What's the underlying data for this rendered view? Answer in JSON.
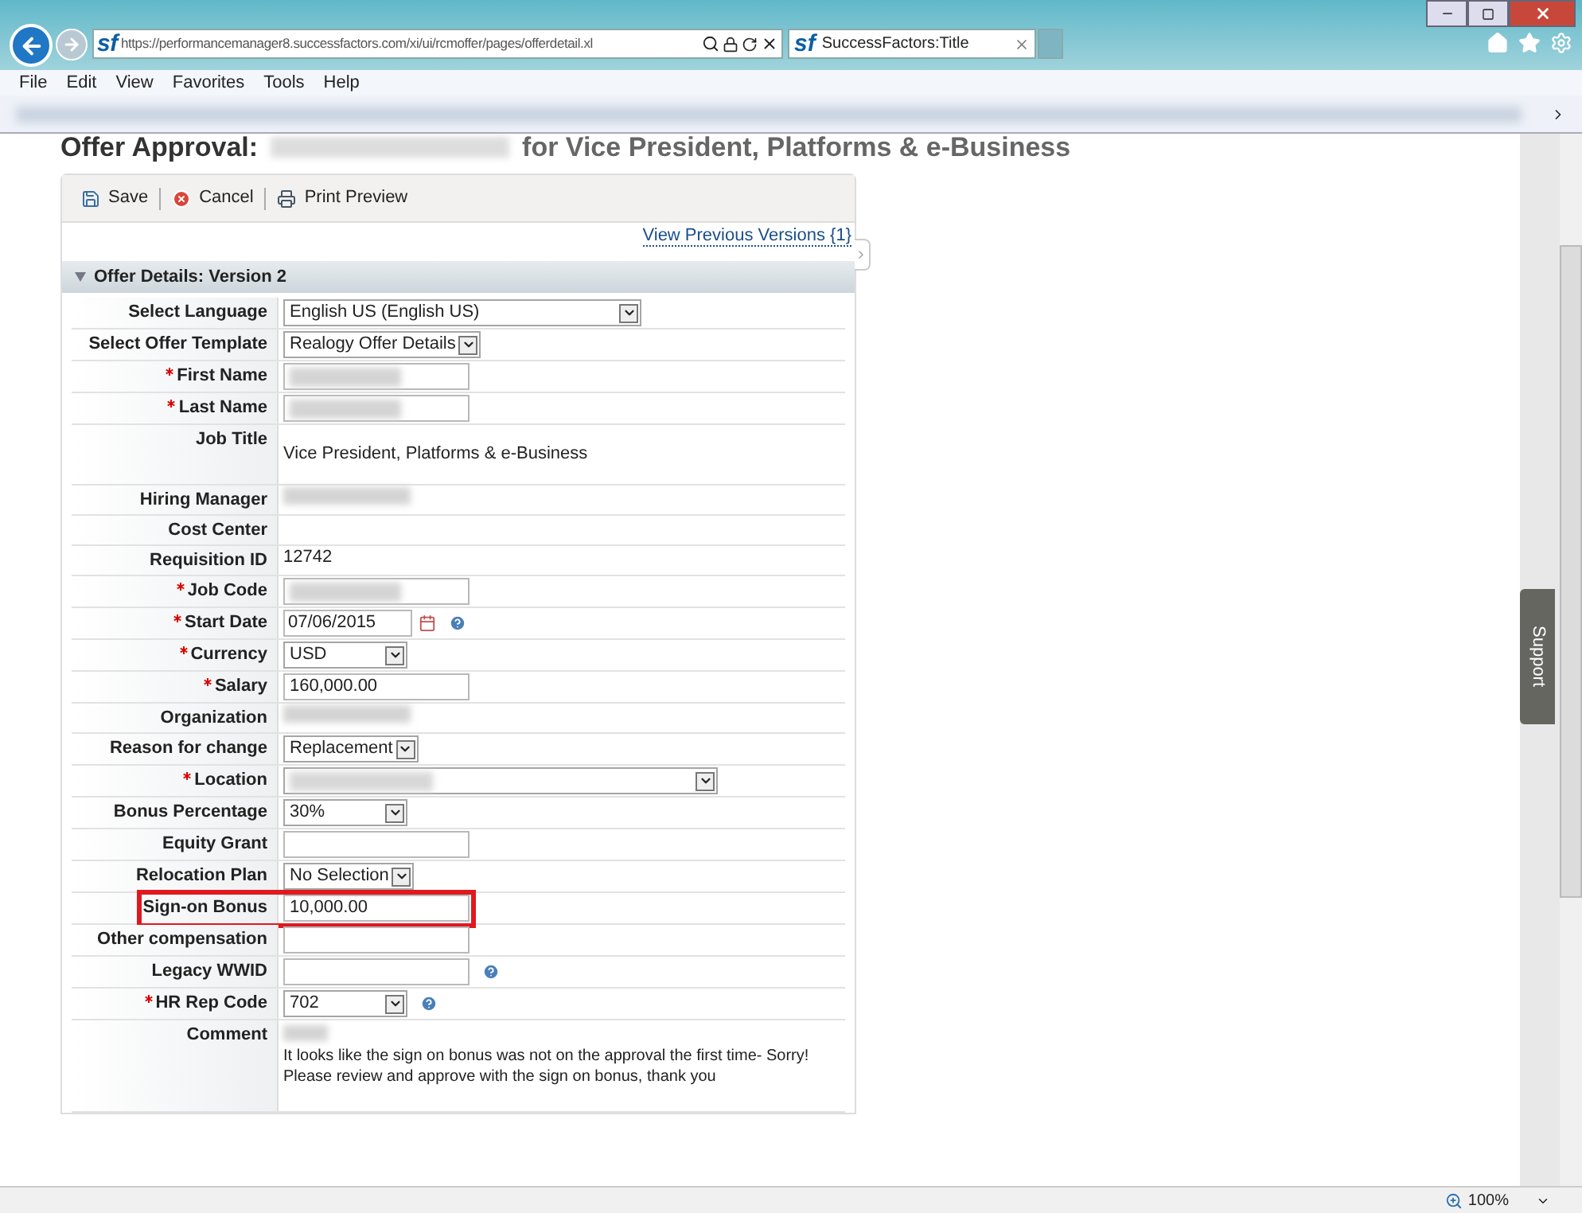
{
  "browser": {
    "url": "https://performancemanager8.successfactors.com/xi/ui/rcmoffer/pages/offerdetail.xl",
    "logo": "sf",
    "tab": {
      "logo": "sf",
      "title": "SuccessFactors:Title",
      "selected": true
    },
    "menu": [
      "File",
      "Edit",
      "View",
      "Favorites",
      "Tools",
      "Help"
    ],
    "zoom": "100%"
  },
  "page": {
    "title_prefix": "Offer Approval:",
    "title_suffix": "for Vice President, Platforms & e-Business",
    "toolbar": [
      {
        "label": "Save",
        "kind": "save"
      },
      {
        "label": "Cancel",
        "kind": "cancel"
      },
      {
        "label": "Print Preview",
        "kind": "print"
      }
    ],
    "versions_link": "View Previous Versions {1}",
    "section": {
      "title": "Offer Details: Version 2",
      "expanded": true
    },
    "fields": [
      {
        "label": "Select Language",
        "required": false,
        "help": false,
        "kind": "dropdown-wide",
        "value": "English US (English US)"
      },
      {
        "label": "Select Offer Template",
        "required": false,
        "help": false,
        "kind": "dropdown-fit",
        "value": "Realogy Offer Details"
      },
      {
        "label": "First Name",
        "required": true,
        "help": false,
        "kind": "input-blurred"
      },
      {
        "label": "Last Name",
        "required": true,
        "help": false,
        "kind": "input-blurred"
      },
      {
        "label": "Job Title",
        "required": false,
        "help": false,
        "kind": "text-tall",
        "value": "Vice President, Platforms & e-Business"
      },
      {
        "label": "Hiring Manager",
        "required": false,
        "help": false,
        "kind": "blurred-text"
      },
      {
        "label": "Cost Center",
        "required": false,
        "help": false,
        "kind": "empty"
      },
      {
        "label": "Requisition ID",
        "required": false,
        "help": false,
        "kind": "text",
        "value": "12742"
      },
      {
        "label": "Job Code",
        "required": true,
        "help": false,
        "kind": "input-blurred"
      },
      {
        "label": "Start Date",
        "required": true,
        "help": true,
        "kind": "date",
        "value": "07/06/2015"
      },
      {
        "label": "Currency",
        "required": true,
        "help": false,
        "kind": "dropdown",
        "value": "USD"
      },
      {
        "label": "Salary",
        "required": true,
        "help": false,
        "kind": "input",
        "value": "160,000.00"
      },
      {
        "label": "Organization",
        "required": false,
        "help": false,
        "kind": "blurred-text"
      },
      {
        "label": "Reason for change",
        "required": false,
        "help": false,
        "kind": "dropdown-fit",
        "value": "Replacement"
      },
      {
        "label": "Location",
        "required": true,
        "help": false,
        "kind": "dropdown-wide-blurred"
      },
      {
        "label": "Bonus Percentage",
        "required": false,
        "help": false,
        "kind": "dropdown",
        "value": "30%"
      },
      {
        "label": "Equity Grant",
        "required": false,
        "help": false,
        "kind": "input"
      },
      {
        "label": "Relocation Plan",
        "required": false,
        "help": false,
        "kind": "dropdown-fit",
        "value": "No Selection"
      },
      {
        "label": "Sign-on Bonus",
        "required": false,
        "help": false,
        "kind": "input",
        "value": "10,000.00",
        "highlighted": true
      },
      {
        "label": "Other compensation",
        "required": false,
        "help": false,
        "kind": "input"
      },
      {
        "label": "Legacy WWID",
        "required": false,
        "help": true,
        "kind": "input"
      },
      {
        "label": "HR Rep Code",
        "required": true,
        "help": true,
        "kind": "dropdown",
        "value": "702"
      },
      {
        "label": "Comment",
        "required": false,
        "help": false,
        "kind": "comment",
        "lines": [
          "It looks like the sign on bonus was not on the approval the first time- Sorry!",
          "Please review and approve with the sign on bonus, thank you"
        ]
      }
    ],
    "support_tab": "Support"
  }
}
